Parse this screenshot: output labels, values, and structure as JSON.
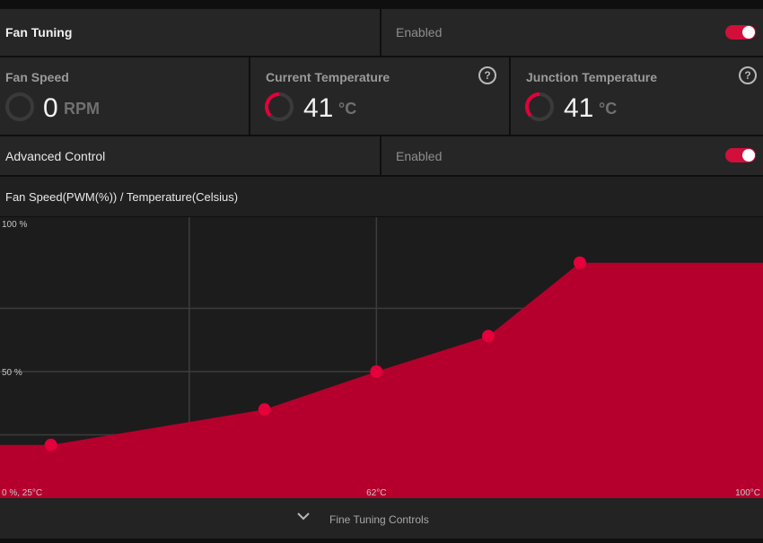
{
  "fan_tuning": {
    "title": "Fan Tuning",
    "status": "Enabled",
    "toggle_on": true
  },
  "stats": {
    "fan_speed": {
      "label": "Fan Speed",
      "value": "0",
      "unit": "RPM"
    },
    "current_temp": {
      "label": "Current Temperature",
      "value": "41",
      "unit": "°C"
    },
    "junction_temp": {
      "label": "Junction Temperature",
      "value": "41",
      "unit": "°C"
    },
    "help_glyph": "?"
  },
  "advanced_control": {
    "title": "Advanced Control",
    "status": "Enabled",
    "toggle_on": true
  },
  "chart_header": {
    "title": "Fan Speed(PWM(%)) / Temperature(Celsius)"
  },
  "chart_data": {
    "type": "area",
    "xlim": [
      25,
      100
    ],
    "ylim": [
      0,
      100
    ],
    "ytick_labels": {
      "top": "100 %",
      "mid": "50 %"
    },
    "xtick_labels": {
      "origin": "0 %, 25°C",
      "mid": "62°C",
      "end": "100°C"
    },
    "grid": true,
    "points": [
      {
        "x": 30,
        "y": 21
      },
      {
        "x": 51,
        "y": 35
      },
      {
        "x": 62,
        "y": 50
      },
      {
        "x": 73,
        "y": 64
      },
      {
        "x": 82,
        "y": 93
      }
    ],
    "colors": {
      "fill": "#b5002e",
      "point": "#e3003b",
      "grid": "#3c3c3c"
    }
  },
  "footer": {
    "label": "Fine Tuning Controls",
    "icon": "chevron-down-icon"
  },
  "colors": {
    "accent": "#d10f3a"
  }
}
